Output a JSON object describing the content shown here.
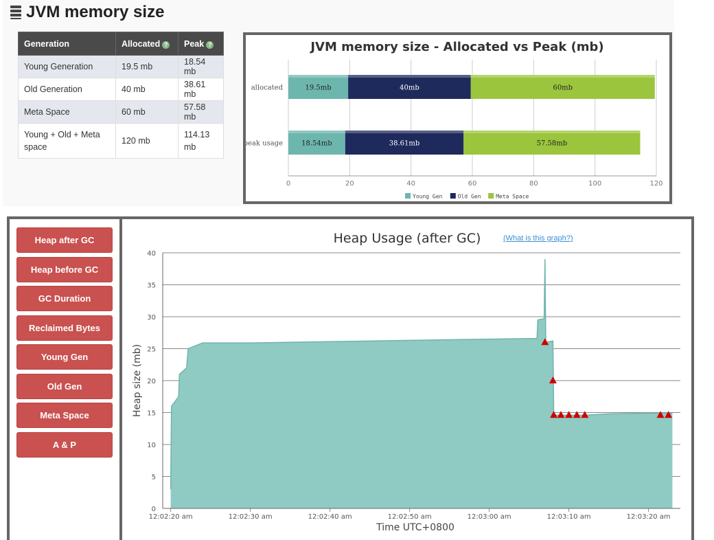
{
  "header": {
    "title": "JVM memory size",
    "icon": "database-icon"
  },
  "table": {
    "headers": [
      "Generation",
      "Allocated",
      "Peak"
    ],
    "rows": [
      [
        "Young Generation",
        "19.5 mb",
        "18.54 mb"
      ],
      [
        "Old Generation",
        "40 mb",
        "38.61 mb"
      ],
      [
        "Meta Space",
        "60 mb",
        "57.58 mb"
      ],
      [
        "Young + Old + Meta space",
        "120 mb",
        "114.13 mb"
      ]
    ]
  },
  "nav": {
    "buttons": [
      "Heap after GC",
      "Heap before GC",
      "GC Duration",
      "Reclaimed Bytes",
      "Young Gen",
      "Old Gen",
      "Meta Space",
      "A & P"
    ],
    "color": "#c9514f"
  },
  "heap": {
    "link_text": "(What is this graph?)"
  },
  "chart_data": [
    {
      "type": "bar",
      "stacked": true,
      "orientation": "horizontal",
      "title": "JVM memory size - Allocated vs Peak (mb)",
      "categories": [
        "allocated",
        "peak usage"
      ],
      "series": [
        {
          "name": "Young Gen",
          "values": [
            19.5,
            18.54
          ],
          "labels": [
            "19.5mb",
            "18.54mb"
          ],
          "color": "#6db6ad"
        },
        {
          "name": "Old Gen",
          "values": [
            40,
            38.61
          ],
          "labels": [
            "40mb",
            "38.61mb"
          ],
          "color": "#1f2a5c"
        },
        {
          "name": "Meta Space",
          "values": [
            60,
            57.58
          ],
          "labels": [
            "60mb",
            "57.58mb"
          ],
          "color": "#9bc53d"
        }
      ],
      "xlim": [
        0,
        120
      ],
      "xticks": [
        0,
        20,
        40,
        60,
        80,
        100,
        120
      ],
      "legend": "bottom"
    },
    {
      "type": "area",
      "title": "Heap Usage (after GC)",
      "xlabel": "Time UTC+0800",
      "ylabel": "Heap size (mb)",
      "ylim": [
        0,
        40
      ],
      "yticks": [
        0,
        5,
        10,
        15,
        20,
        25,
        30,
        35,
        40
      ],
      "xlim": [
        "12:02:19",
        "12:03:24"
      ],
      "xticks": [
        "12:02:20 am",
        "12:02:30 am",
        "12:02:40 am",
        "12:02:50 am",
        "12:03:00 am",
        "12:03:10 am",
        "12:03:20 am"
      ],
      "grid": true,
      "color": "#8fcbc2",
      "line_color": "#6fb5aa",
      "marker_color": "#d00000",
      "points": [
        [
          "12:02:20.0",
          3
        ],
        [
          "12:02:20.1",
          16
        ],
        [
          "12:02:21.0",
          17.5
        ],
        [
          "12:02:21.1",
          21
        ],
        [
          "12:02:22.0",
          22
        ],
        [
          "12:02:22.2",
          25
        ],
        [
          "12:02:24.0",
          25.9
        ],
        [
          "12:02:30.0",
          25.9
        ],
        [
          "12:02:40.0",
          26.1
        ],
        [
          "12:02:50.0",
          26.3
        ],
        [
          "12:03:00.0",
          26.5
        ],
        [
          "12:03:06.0",
          26.6
        ],
        [
          "12:03:06.1",
          29.5
        ],
        [
          "12:03:06.9",
          29.7
        ],
        [
          "12:03:07.0",
          39
        ],
        [
          "12:03:07.1",
          26.0
        ],
        [
          "12:03:08.0",
          26.2
        ],
        [
          "12:03:08.1",
          14.6
        ],
        [
          "12:03:10.0",
          14.6
        ],
        [
          "12:03:11.0",
          14.6
        ],
        [
          "12:03:12.0",
          14.6
        ],
        [
          "12:03:15.0",
          14.8
        ],
        [
          "12:03:20.0",
          14.9
        ],
        [
          "12:03:23.0",
          14.9
        ]
      ],
      "gc_markers": [
        [
          "12:03:07.0",
          26
        ],
        [
          "12:03:08.0",
          20
        ],
        [
          "12:03:08.1",
          14.6
        ],
        [
          "12:03:09.0",
          14.6
        ],
        [
          "12:03:10.0",
          14.6
        ],
        [
          "12:03:11.0",
          14.6
        ],
        [
          "12:03:12.0",
          14.6
        ],
        [
          "12:03:21.5",
          14.6
        ],
        [
          "12:03:22.5",
          14.6
        ]
      ]
    }
  ]
}
